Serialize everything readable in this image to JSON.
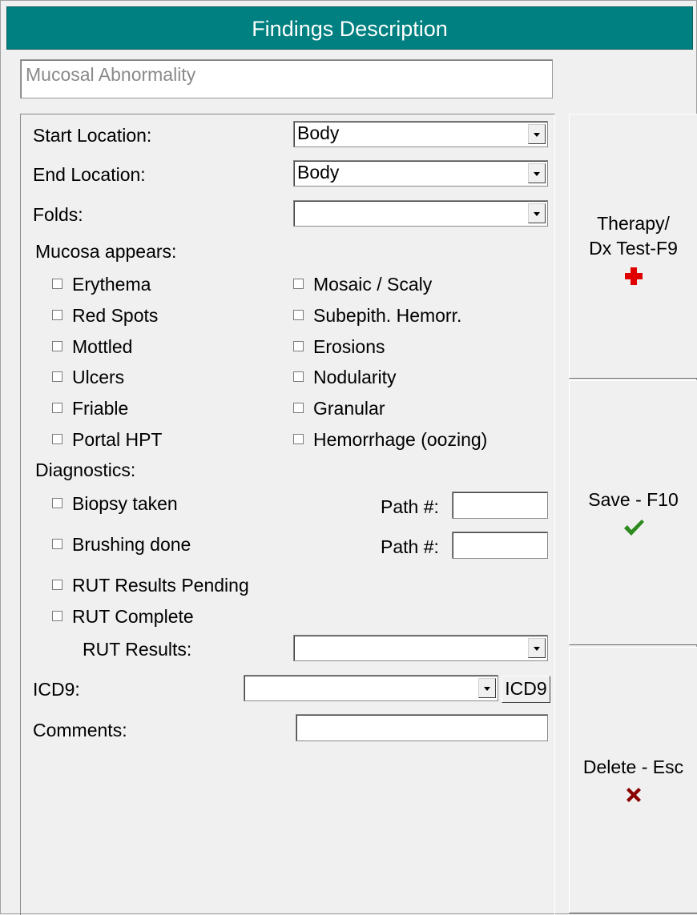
{
  "window": {
    "title": "Findings Description"
  },
  "finding_name": "Mucosal Abnormality",
  "form": {
    "start_location": {
      "label": "Start Location:",
      "value": "Body"
    },
    "end_location": {
      "label": "End Location:",
      "value": "Body"
    },
    "folds": {
      "label": "Folds:",
      "value": ""
    },
    "mucosa_header": "Mucosa appears:",
    "mucosa_left": [
      "Erythema",
      "Red Spots",
      "Mottled",
      "Ulcers",
      "Friable",
      "Portal HPT"
    ],
    "mucosa_right": [
      "Mosaic / Scaly",
      "Subepith. Hemorr.",
      "Erosions",
      "Nodularity",
      "Granular",
      "Hemorrhage (oozing)"
    ],
    "diagnostics_header": "Diagnostics:",
    "biopsy_label": "Biopsy taken",
    "brushing_label": "Brushing done",
    "path_label": "Path #:",
    "rut_pending_label": "RUT Results Pending",
    "rut_complete_label": "RUT Complete",
    "rut_results": {
      "label": "RUT Results:",
      "value": ""
    },
    "icd9": {
      "label": "ICD9:",
      "value": "",
      "button": "ICD9"
    },
    "comments": {
      "label": "Comments:",
      "value": ""
    }
  },
  "buttons": {
    "therapy_line1": "Therapy/",
    "therapy_line2": "Dx Test-F9",
    "save": "Save - F10",
    "delete": "Delete - Esc"
  },
  "icons": {
    "therapy": "red-cross-icon",
    "save": "green-check-icon",
    "delete": "red-x-icon"
  },
  "colors": {
    "title_bg": "#008080",
    "cross": "#e00000",
    "check": "#2c8a1e",
    "x": "#8b0000"
  }
}
